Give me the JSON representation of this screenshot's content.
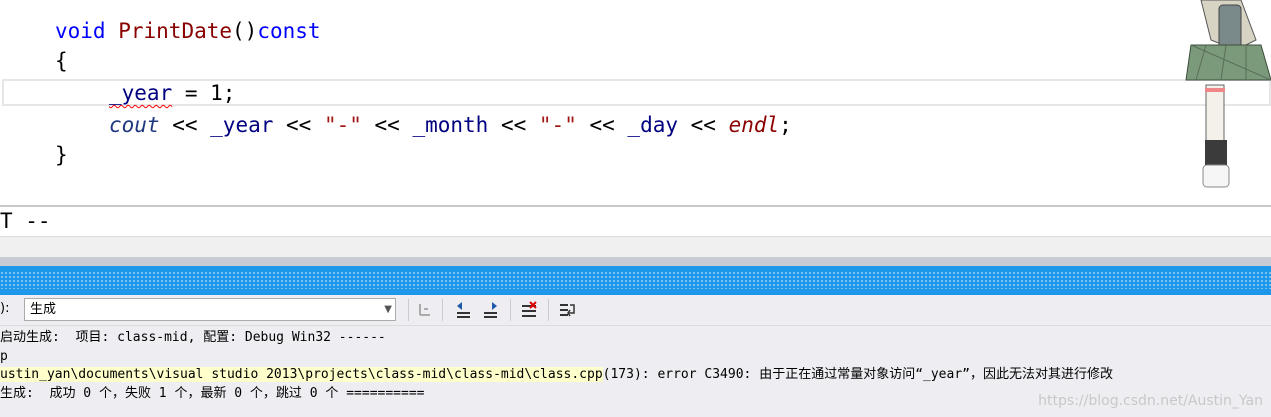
{
  "editor": {
    "line1": {
      "kw": "void",
      "fn": "PrintDate",
      "paren": "()",
      "const": "const"
    },
    "line2": "{",
    "line3": {
      "ident": "_year",
      "rest": " = 1;"
    },
    "line4": {
      "cout": "cout",
      "op1": " << ",
      "year": "_year",
      "op2": " << ",
      "dash1": "\"-\"",
      "op3": " << ",
      "month": "_month",
      "op4": " << ",
      "dash2": "\"-\"",
      "op5": " << ",
      "day": "_day",
      "op6": " << ",
      "endl": "endl",
      "semi": ";"
    },
    "line5": "}"
  },
  "between": {
    "text": "T --"
  },
  "output_panel": {
    "source_label": "):",
    "source_value": "生成",
    "lines": [
      "启动生成:  项目: class-mid, 配置: Debug Win32 ------",
      "p",
      "ustin_yan\\documents\\visual studio 2013\\projects\\class-mid\\class-mid\\class.cpp",
      "(173): error C3490: 由于正在通过常量对象访问“_year”，因此无法对其进行修改",
      "生成:  成功 0 个，失败 1 个，最新 0 个，跳过 0 个 =========="
    ]
  },
  "watermark": "https://blog.csdn.net/Austin_Yan",
  "colors": {
    "keyword": "#0000ff",
    "function": "#880000",
    "panel_accent": "#1c97ea"
  }
}
